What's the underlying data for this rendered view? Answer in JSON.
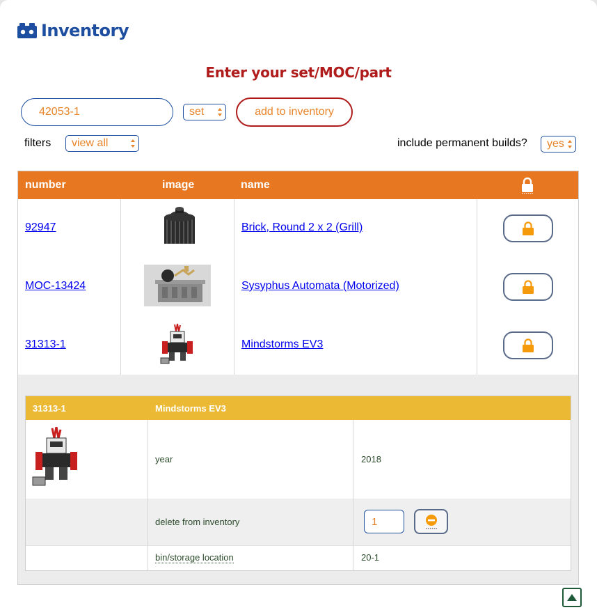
{
  "app": {
    "title": "Inventory",
    "logo_icon": "brick-icon",
    "brand_color": "#1d4ea0"
  },
  "prompt": "Enter your set/MOC/part",
  "lookup": {
    "value": "42053-1",
    "type_selected": "set",
    "add_label": "add to inventory"
  },
  "filters": {
    "label": "filters",
    "selected": "view all"
  },
  "permanent": {
    "label": "include permanent builds?",
    "selected": "yes"
  },
  "table": {
    "headers": {
      "number": "number",
      "image": "image",
      "name": "name",
      "lock_icon": "lock-icon"
    },
    "rows": [
      {
        "number": "92947",
        "name": "Brick, Round 2 x 2 (Grill)",
        "image_icon": "brick-part-image"
      },
      {
        "number": "MOC-13424",
        "name": "Sysyphus Automata (Motorized)",
        "image_icon": "automata-image"
      },
      {
        "number": "31313-1",
        "name": "Mindstorms EV3",
        "image_icon": "robot-image"
      }
    ]
  },
  "detail": {
    "number": "31313-1",
    "name": "Mindstorms EV3",
    "year_label": "year",
    "year_value": "2018",
    "delete_label": "delete from inventory",
    "quantity": "1",
    "storage_label": "bin/storage location",
    "storage_value": "20-1"
  },
  "colors": {
    "header_orange": "#e87722",
    "detail_gold": "#ebb933",
    "accent_red": "#b01c1c",
    "lock_orange": "#f59a0b"
  }
}
